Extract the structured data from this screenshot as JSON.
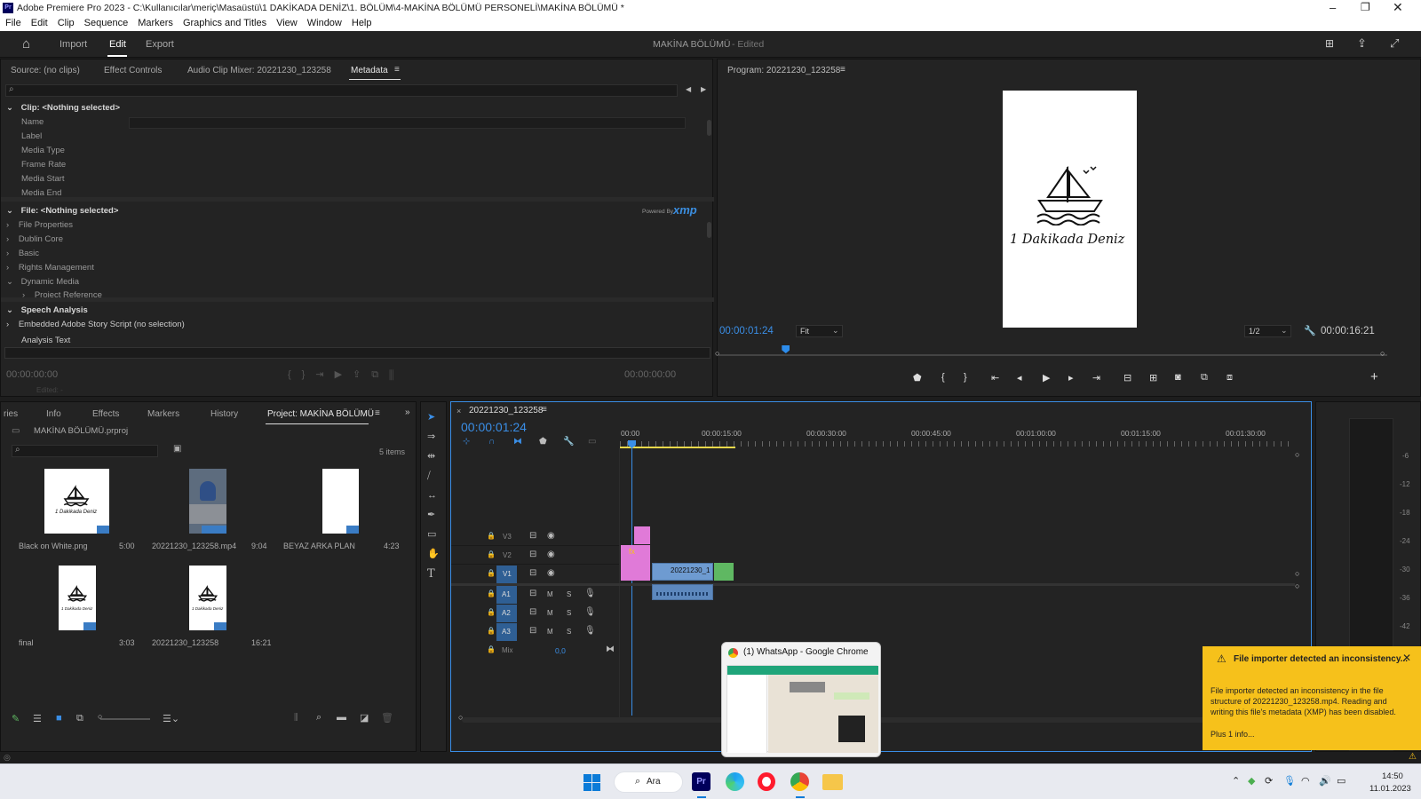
{
  "window": {
    "title": "Adobe Premiere Pro 2023 - C:\\Kullanıcılar\\meriç\\Masaüstü\\1 DAKİKADA DENİZ\\1. BÖLÜM\\4-MAKİNA BÖLÜMÜ PERSONELİ\\MAKİNA BÖLÜMÜ *",
    "app_badge": "Pr"
  },
  "menu": [
    "File",
    "Edit",
    "Clip",
    "Sequence",
    "Markers",
    "Graphics and Titles",
    "View",
    "Window",
    "Help"
  ],
  "workspace": {
    "tabs": [
      "Import",
      "Edit",
      "Export"
    ],
    "project_name": "MAKİNA BÖLÜMÜ",
    "status": "- Edited"
  },
  "source_panel": {
    "tabs": [
      "Source: (no clips)",
      "Effect Controls",
      "Audio Clip Mixer: 20221230_123258",
      "Metadata"
    ],
    "clip_header": "Clip:  <Nothing selected>",
    "clip_fields": [
      "Name",
      "Label",
      "Media Type",
      "Frame Rate",
      "Media Start",
      "Media End"
    ],
    "file_header": "File:  <Nothing selected>",
    "powered_by": "Powered By",
    "xmp": "xmp",
    "file_sections": [
      "File Properties",
      "Dublin Core",
      "Basic",
      "Rights Management",
      "Dynamic Media"
    ],
    "sub_section": "Project Reference",
    "speech": "Speech Analysis",
    "story": "Embedded Adobe Story Script (no selection)",
    "analysis": "Analysis Text",
    "tc_left": "00:00:00:00",
    "tc_right": "00:00:00:00",
    "edited": "Edited: -"
  },
  "program_panel": {
    "title": "Program: 20221230_123258",
    "frame_text": "1 Dakikada Deniz",
    "timecode": "00:00:01:24",
    "fit": "Fit",
    "resolution": "1/2",
    "duration": "00:00:16:21",
    "playhead_fraction": 0.1
  },
  "project_panel": {
    "tabs": [
      "ries",
      "Info",
      "Effects",
      "Markers",
      "History",
      "Project: MAKİNA BÖLÜMÜ"
    ],
    "file": "MAKİNA BÖLÜMÜ.prproj",
    "items_count": "5 items",
    "items": [
      {
        "name": "Black on White.png",
        "dur": "5:00"
      },
      {
        "name": "20221230_123258.mp4",
        "dur": "9:04"
      },
      {
        "name": "BEYAZ ARKA PLAN",
        "dur": "4:23"
      },
      {
        "name": "final",
        "dur": "3:03"
      },
      {
        "name": "20221230_123258",
        "dur": "16:21"
      }
    ],
    "logo_text": "1 Dakikada Deniz"
  },
  "timeline": {
    "sequence": "20221230_123258",
    "timecode": "00:00:01:24",
    "ruler": [
      "00:00",
      "00:00:15:00",
      "00:00:30:00",
      "00:00:45:00",
      "00:01:00:00",
      "00:01:15:00",
      "00:01:30:00"
    ],
    "video_tracks": [
      "V3",
      "V2",
      "V1"
    ],
    "audio_tracks": [
      "A1",
      "A2",
      "A3"
    ],
    "mix_label": "Mix",
    "mix_value": "0,0",
    "clip_label": "20221230_1",
    "m": "M",
    "s": "S"
  },
  "meter": {
    "ticks": [
      "-6",
      "-12",
      "-18",
      "-24",
      "-30",
      "-36",
      "-42"
    ]
  },
  "chrome_preview": {
    "title": "(1) WhatsApp - Google Chrome"
  },
  "notification": {
    "title": "File importer detected an inconsistency...",
    "body": "File importer detected an inconsistency in the file structure of 20221230_123258.mp4. Reading and writing this file's metadata (XMP) has been disabled.",
    "link": "Plus 1 info..."
  },
  "taskbar": {
    "search": "Ara",
    "time": "14:50",
    "date": "11.01.2023",
    "pr": "Pr"
  },
  "colors": {
    "accent": "#2d8ceb",
    "pink": "#e07ad8",
    "clip_blue": "#6e9bd1",
    "green": "#5fb862",
    "warning": "#f6c11b"
  }
}
